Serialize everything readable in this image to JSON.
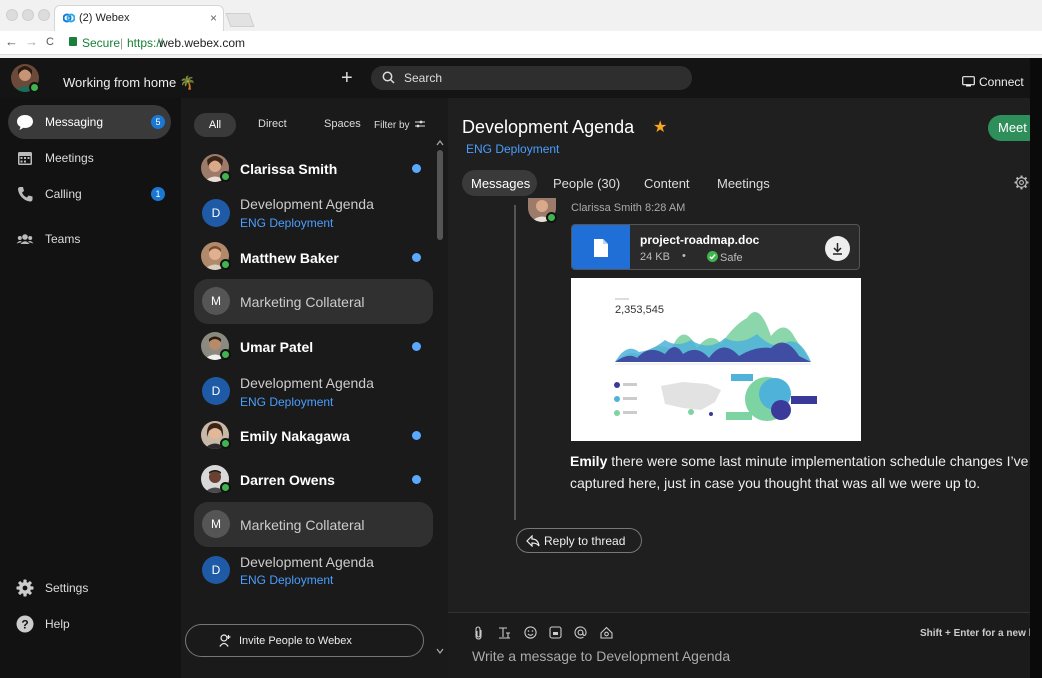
{
  "browser": {
    "tab_title": "(2) Webex",
    "tab_close": "×",
    "secure_label": "Secure",
    "url_scheme": "https://",
    "url_host": "web.webex.com",
    "back": "←",
    "forward": "→",
    "reload": "C"
  },
  "topbar": {
    "status": "Working from home 🌴",
    "plus": "+",
    "search_label": "Search",
    "connect_label": "Connect"
  },
  "leftnav": {
    "items": [
      {
        "label": "Messaging",
        "badge": "5",
        "icon": "chat-bubble-icon"
      },
      {
        "label": "Meetings",
        "badge": "",
        "icon": "calendar-icon"
      },
      {
        "label": "Calling",
        "badge": "1",
        "icon": "phone-icon"
      },
      {
        "label": "Teams",
        "badge": "",
        "icon": "team-icon"
      }
    ],
    "settings_label": "Settings",
    "help_label": "Help"
  },
  "spacelist": {
    "filters": [
      "All",
      "Direct",
      "Spaces"
    ],
    "filter_by": "Filter by",
    "rows": [
      {
        "name": "Clarissa Smith",
        "sub": "",
        "type": "person",
        "unread": true
      },
      {
        "name": "Development Agenda",
        "sub": "ENG Deployment",
        "type": "space",
        "letter": "D",
        "unread": false
      },
      {
        "name": "Matthew Baker",
        "sub": "",
        "type": "person",
        "unread": true
      },
      {
        "name": "Marketing Collateral",
        "sub": "",
        "type": "space",
        "letter": "M",
        "unread": false
      },
      {
        "name": "Umar Patel",
        "sub": "",
        "type": "person",
        "unread": true
      },
      {
        "name": "Development Agenda",
        "sub": "ENG Deployment",
        "type": "space",
        "letter": "D",
        "unread": false
      },
      {
        "name": "Emily Nakagawa",
        "sub": "",
        "type": "person",
        "unread": true
      },
      {
        "name": "Darren Owens",
        "sub": "",
        "type": "person",
        "unread": true
      },
      {
        "name": "Marketing Collateral",
        "sub": "",
        "type": "space",
        "letter": "M",
        "unread": false
      },
      {
        "name": "Development Agenda",
        "sub": "ENG Deployment",
        "type": "space",
        "letter": "D",
        "unread": false
      }
    ],
    "invite_label": "Invite People to Webex"
  },
  "main": {
    "title": "Development Agenda",
    "subtitle": "ENG Deployment",
    "meet_label": "Meet",
    "tabs": [
      "Messages",
      "People (30)",
      "Content",
      "Meetings"
    ],
    "message": {
      "author_meta": "Clarissa Smith  8:28 AM",
      "file_name": "project-roadmap.doc",
      "file_size": "24 KB",
      "file_safe": "Safe",
      "chart_number": "2,353,545",
      "author": "Emily",
      "text": " there were some last minute implementation schedule changes I’ve captured here, just in case you thought that was all we were up to."
    },
    "reply_label": "Reply to thread",
    "compose_hint": "Shift + Enter for a new l",
    "compose_placeholder": "Write a message to Development Agenda"
  },
  "colors": {
    "accent_blue": "#4a9eff",
    "meet_green": "#2f8f5a",
    "unread_dot": "#5aa9ff",
    "presence_green": "#3fb44f",
    "star": "#f5a623"
  }
}
